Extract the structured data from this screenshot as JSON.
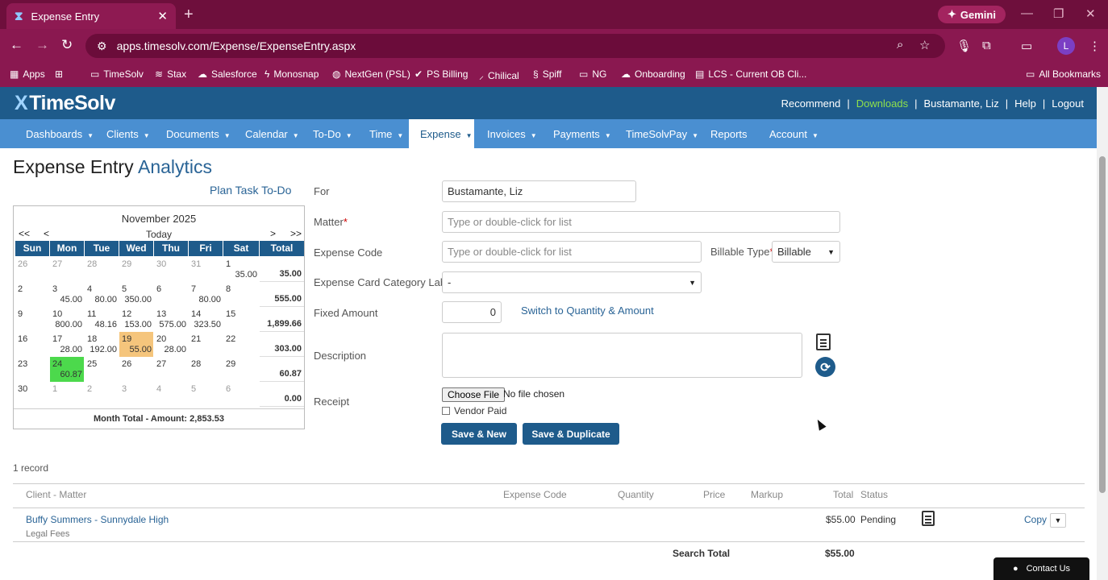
{
  "browser": {
    "tab_title": "Expense Entry",
    "url": "apps.timesolv.com/Expense/ExpenseEntry.aspx",
    "gemini_label": "Gemini",
    "profile_initial": "L",
    "bookmarks": [
      "Apps",
      "TimeSolv",
      "Stax",
      "Salesforce",
      "Monosnap",
      "NextGen (PSL)",
      "PS Billing",
      "Chilical",
      "Spiff",
      "NG",
      "Onboarding",
      "LCS - Current OB Cli..."
    ],
    "all_bookmarks": "All Bookmarks"
  },
  "app": {
    "logo": "TimeSolv",
    "top_links": {
      "recommend": "Recommend",
      "downloads": "Downloads",
      "user": "Bustamante, Liz",
      "help": "Help",
      "logout": "Logout",
      "sep": "|"
    },
    "nav": [
      "Dashboards",
      "Clients",
      "Documents",
      "Calendar",
      "To-Do",
      "Time",
      "Expense",
      "Invoices",
      "Payments",
      "TimeSolvPay",
      "Reports",
      "Account"
    ],
    "nav_active": "Expense",
    "accent": "#1e5b8b",
    "nav_color": "#4a8fd1"
  },
  "page": {
    "title": "Expense Entry",
    "analytics_tab": "Analytics",
    "plan_link": "Plan Task To-Do"
  },
  "calendar": {
    "month": "November 2025",
    "today": "Today",
    "nav": [
      "<<",
      "<",
      ">",
      ">>"
    ],
    "dow": [
      "Sun",
      "Mon",
      "Tue",
      "Wed",
      "Thu",
      "Fri",
      "Sat",
      "Total"
    ],
    "weeks": [
      {
        "days": [
          {
            "d": "26",
            "dim": true
          },
          {
            "d": "27",
            "dim": true
          },
          {
            "d": "28",
            "dim": true
          },
          {
            "d": "29",
            "dim": true
          },
          {
            "d": "30",
            "dim": true
          },
          {
            "d": "31",
            "dim": true
          },
          {
            "d": "1",
            "a": "35.00"
          }
        ],
        "total": "35.00"
      },
      {
        "days": [
          {
            "d": "2"
          },
          {
            "d": "3",
            "a": "45.00"
          },
          {
            "d": "4",
            "a": "80.00"
          },
          {
            "d": "5",
            "a": "350.00"
          },
          {
            "d": "6"
          },
          {
            "d": "7",
            "a": "80.00"
          },
          {
            "d": "8"
          }
        ],
        "total": "555.00"
      },
      {
        "days": [
          {
            "d": "9"
          },
          {
            "d": "10",
            "a": "800.00"
          },
          {
            "d": "11",
            "a": "48.16"
          },
          {
            "d": "12",
            "a": "153.00"
          },
          {
            "d": "13",
            "a": "575.00"
          },
          {
            "d": "14",
            "a": "323.50"
          },
          {
            "d": "15"
          }
        ],
        "total": "1,899.66"
      },
      {
        "days": [
          {
            "d": "16"
          },
          {
            "d": "17",
            "a": "28.00"
          },
          {
            "d": "18",
            "a": "192.00"
          },
          {
            "d": "19",
            "a": "55.00",
            "hl": "orange"
          },
          {
            "d": "20",
            "a": "28.00"
          },
          {
            "d": "21"
          },
          {
            "d": "22"
          }
        ],
        "total": "303.00"
      },
      {
        "days": [
          {
            "d": "23"
          },
          {
            "d": "24",
            "a": "60.87",
            "hl": "green"
          },
          {
            "d": "25"
          },
          {
            "d": "26"
          },
          {
            "d": "27"
          },
          {
            "d": "28"
          },
          {
            "d": "29"
          }
        ],
        "total": "60.87"
      },
      {
        "days": [
          {
            "d": "30"
          },
          {
            "d": "1",
            "dim": true
          },
          {
            "d": "2",
            "dim": true
          },
          {
            "d": "3",
            "dim": true
          },
          {
            "d": "4",
            "dim": true
          },
          {
            "d": "5",
            "dim": true
          },
          {
            "d": "6",
            "dim": true
          }
        ],
        "total": "0.00"
      }
    ],
    "month_total": "Month Total - Amount: 2,853.53"
  },
  "form": {
    "for_label": "For",
    "for_value": "Bustamante, Liz",
    "matter_label": "Matter",
    "matter_placeholder": "Type or double-click for list",
    "expense_code_label": "Expense Code",
    "expense_code_placeholder": "Type or double-click for list",
    "billable_type_label": "Billable Type",
    "billable_type_value": "Billable",
    "card_category_label": "Expense Card Category Label",
    "card_category_value": "-",
    "fixed_amount_label": "Fixed Amount",
    "fixed_amount_value": "0",
    "switch_link": "Switch to Quantity & Amount",
    "description_label": "Description",
    "receipt_label": "Receipt",
    "choose_file": "Choose File",
    "no_file": "No file chosen",
    "vendor_paid": "Vendor Paid",
    "required_mark": "*",
    "save_new": "Save & New",
    "save_duplicate": "Save & Duplicate"
  },
  "records": {
    "count": "1 record",
    "headers": {
      "client_matter": "Client - Matter",
      "expense_code": "Expense Code",
      "quantity": "Quantity",
      "price": "Price",
      "markup": "Markup",
      "total": "Total",
      "status": "Status"
    },
    "rows": [
      {
        "client_matter": "Buffy Summers - Sunnydale High",
        "sub": "Legal Fees",
        "total": "$55.00",
        "status": "Pending",
        "copy": "Copy"
      }
    ],
    "search_total_label": "Search Total",
    "search_total_value": "$55.00"
  },
  "contact": "Contact Us"
}
